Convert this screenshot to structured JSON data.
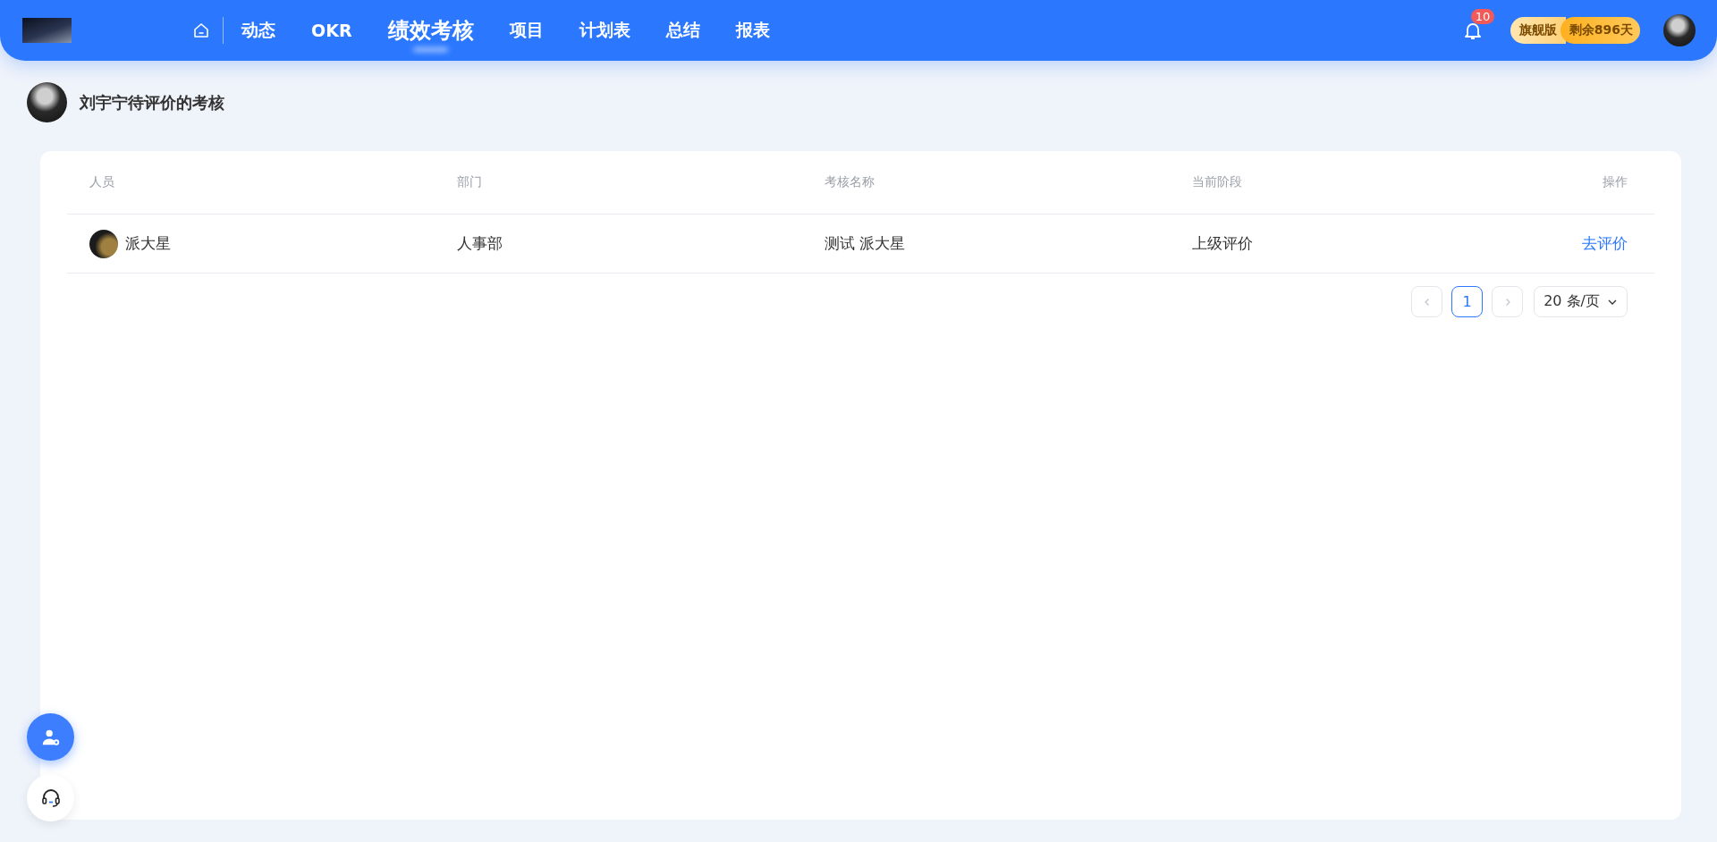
{
  "header": {
    "nav": [
      {
        "label": "动态",
        "selected": false
      },
      {
        "label": "OKR",
        "selected": false
      },
      {
        "label": "绩效考核",
        "selected": true
      },
      {
        "label": "项目",
        "selected": false
      },
      {
        "label": "计划表",
        "selected": false
      },
      {
        "label": "总结",
        "selected": false
      },
      {
        "label": "报表",
        "selected": false
      }
    ],
    "notification_count": "10",
    "plan": {
      "edition": "旗舰版",
      "remaining": "剩余896天"
    }
  },
  "page_title": "刘宇宁待评价的考核",
  "table": {
    "columns": [
      "人员",
      "部门",
      "考核名称",
      "当前阶段",
      "操作"
    ],
    "rows": [
      {
        "person": "派大星",
        "department": "人事部",
        "review_name": "测试 派大星",
        "stage": "上级评价",
        "action": "去评价"
      }
    ]
  },
  "pagination": {
    "pages": [
      {
        "label": "1",
        "selected": true
      }
    ],
    "page_size": "20 条/页"
  }
}
